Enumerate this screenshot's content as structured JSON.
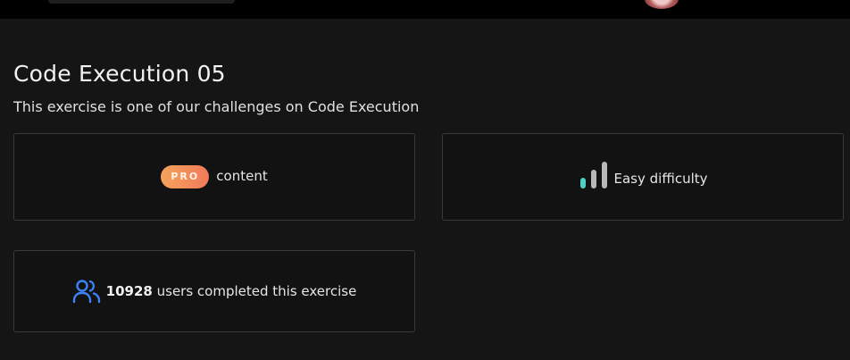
{
  "exercise": {
    "title": "Code Execution 05",
    "subtitle": "This exercise is one of our challenges on Code Execution"
  },
  "cards": {
    "pro": {
      "badge": "PRO",
      "text": "content"
    },
    "difficulty": {
      "text": "Easy difficulty",
      "level": 1,
      "max_level": 3,
      "active_color": "#4fd1c5",
      "inactive_color": "#b8b8b8",
      "icon": "difficulty-bars-icon"
    },
    "users": {
      "count": "10928",
      "text": "users completed this exercise",
      "icon": "users-icon",
      "icon_color": "#3b82f6"
    }
  },
  "colors": {
    "background": "#151515",
    "topbar": "#000000",
    "card_border": "#3a3a3a",
    "pro_gradient_start": "#f5a35b",
    "pro_gradient_end": "#f07a5a"
  }
}
